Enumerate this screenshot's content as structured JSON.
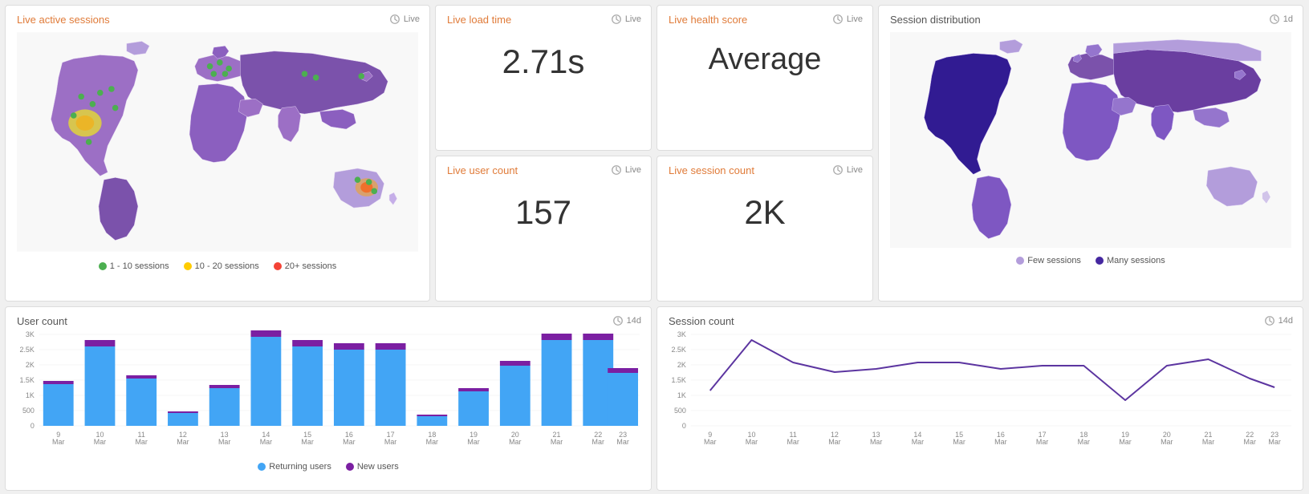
{
  "cards": {
    "active_sessions": {
      "title": "Live active sessions",
      "badge": "Live",
      "legend": [
        {
          "color": "#4caf50",
          "label": "1 - 10 sessions"
        },
        {
          "color": "#ffcc00",
          "label": "10 - 20 sessions"
        },
        {
          "color": "#f44336",
          "label": "20+ sessions"
        }
      ]
    },
    "load_time": {
      "title": "Live load time",
      "badge": "Live",
      "value": "2.71s"
    },
    "health_score": {
      "title": "Live health score",
      "badge": "Live",
      "value": "Average"
    },
    "user_count_live": {
      "title": "Live user count",
      "badge": "Live",
      "value": "157"
    },
    "session_count_live": {
      "title": "Live session count",
      "badge": "Live",
      "value": "2K"
    },
    "session_dist": {
      "title": "Session distribution",
      "badge": "1d",
      "legend": [
        {
          "color": "#b39ddb",
          "label": "Few sessions"
        },
        {
          "color": "#4527a0",
          "label": "Many sessions"
        }
      ]
    },
    "user_count": {
      "title": "User count",
      "badge": "14d",
      "legend": [
        {
          "color": "#42a5f5",
          "label": "Returning users"
        },
        {
          "color": "#7b1fa2",
          "label": "New users"
        }
      ],
      "x_labels": [
        "9\nMar",
        "10\nMar",
        "11\nMar",
        "12\nMar",
        "13\nMar",
        "14\nMar",
        "15\nMar",
        "16\nMar",
        "17\nMar",
        "18\nMar",
        "19\nMar",
        "20\nMar",
        "21\nMar",
        "22\nMar",
        "23\nMar"
      ],
      "y_labels": [
        "3K",
        "2.5K",
        "2K",
        "1.5K",
        "1K",
        "500",
        "0"
      ],
      "returning": [
        1300,
        2500,
        1500,
        400,
        1200,
        2800,
        2500,
        2400,
        2400,
        300,
        1100,
        1900,
        2700,
        2700,
        1700
      ],
      "new": [
        100,
        200,
        100,
        50,
        100,
        200,
        200,
        200,
        200,
        50,
        100,
        150,
        200,
        200,
        150
      ]
    },
    "session_count": {
      "title": "Session count",
      "badge": "14d",
      "x_labels": [
        "9\nMar",
        "10\nMar",
        "11\nMar",
        "12\nMar",
        "13\nMar",
        "14\nMar",
        "15\nMar",
        "16\nMar",
        "17\nMar",
        "18\nMar",
        "19\nMar",
        "20\nMar",
        "21\nMar",
        "22\nMar",
        "23\nMar"
      ],
      "y_labels": [
        "3K",
        "2.5K",
        "2K",
        "1.5K",
        "1K",
        "500",
        "0"
      ],
      "values": [
        1100,
        2700,
        2000,
        1700,
        1800,
        2000,
        2000,
        1800,
        1900,
        1900,
        800,
        1900,
        2100,
        1500,
        1200
      ]
    }
  }
}
